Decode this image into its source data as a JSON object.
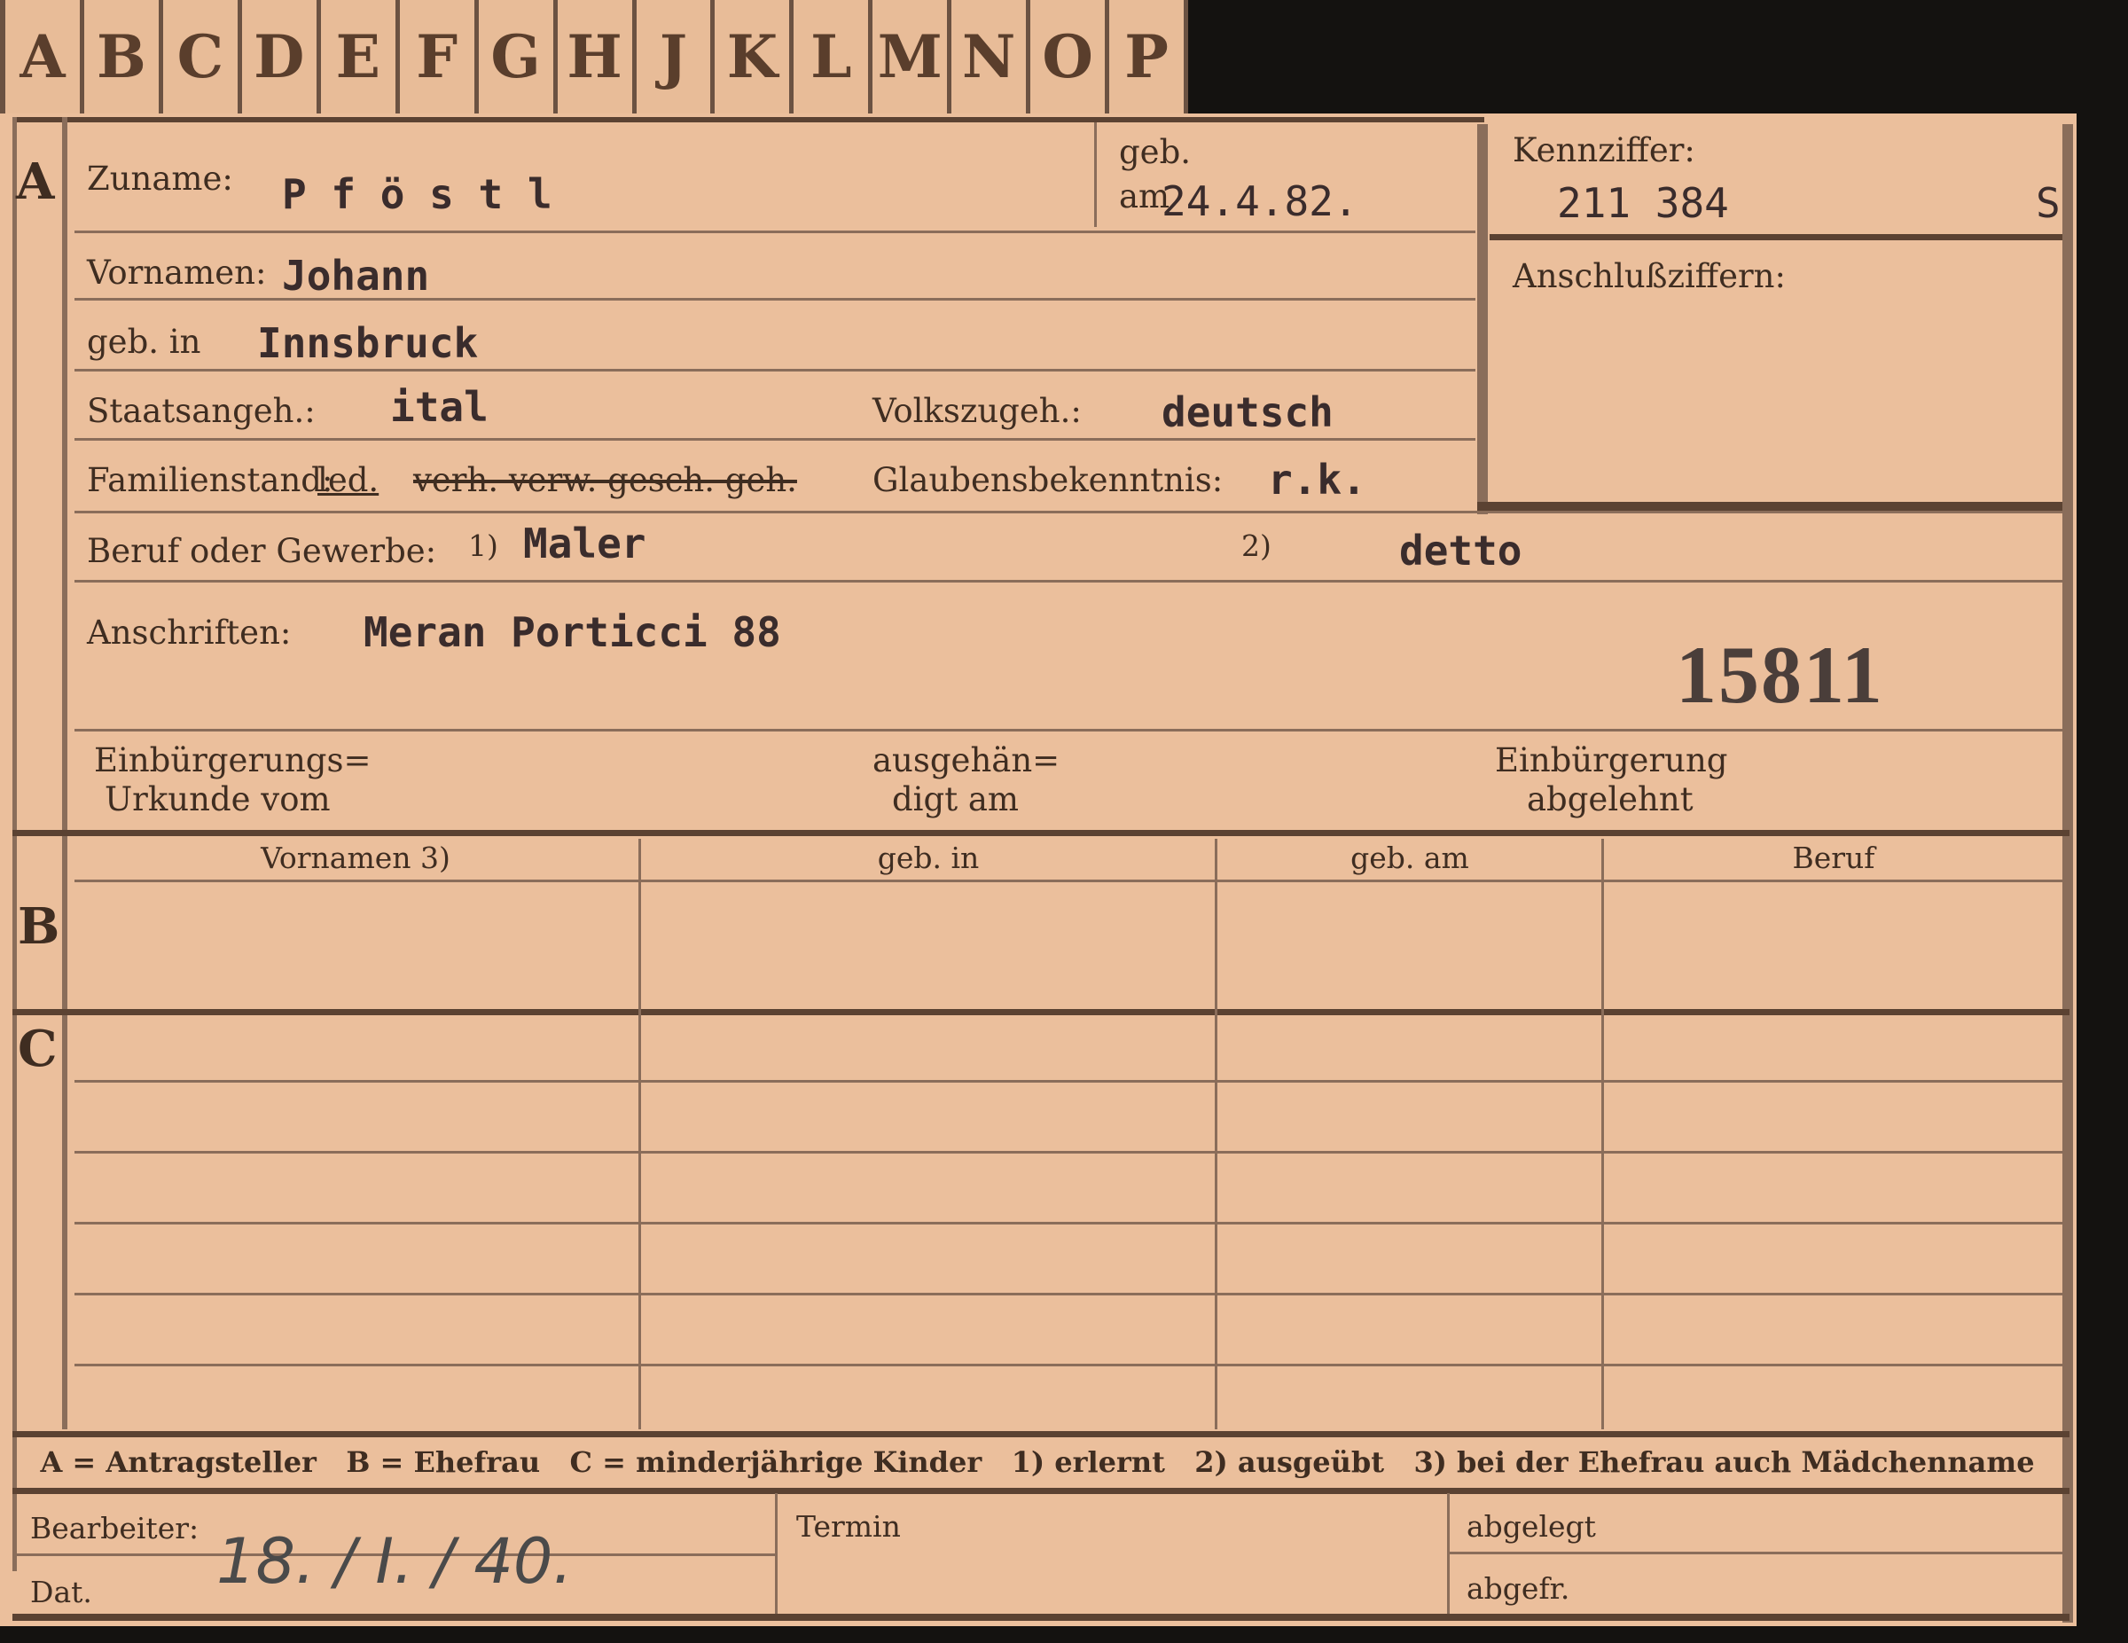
{
  "tabs": [
    "A",
    "B",
    "C",
    "D",
    "E",
    "F",
    "G",
    "H",
    "J",
    "K",
    "L",
    "M",
    "N",
    "O",
    "P"
  ],
  "sections": {
    "a": "A",
    "b": "B",
    "c": "C"
  },
  "header": {
    "zuname_label": "Zuname:",
    "zuname_value": "P f ö s t l",
    "geb_am_label_1": "geb.",
    "geb_am_label_2": "am",
    "geb_am_value": "24.4.82.",
    "kennziffer_label": "Kennziffer:",
    "kennziffer_value": "211 384",
    "kennziffer_suffix": "S",
    "anschluss_label": "Anschlußziffern:"
  },
  "fields": {
    "vornamen_label": "Vornamen:",
    "vornamen_value": "Johann",
    "geb_in_label": "geb. in",
    "geb_in_value": "Innsbruck",
    "staatsangeh_label": "Staatsangeh.:",
    "staatsangeh_value": "ital",
    "volkszugeh_label": "Volkszugeh.:",
    "volkszugeh_value": "deutsch",
    "familienstand_label": "Familienstand:",
    "familienstand_kept": "led.",
    "familienstand_struck": "verh. verw. gesch. geh.",
    "glauben_label": "Glaubensbekenntnis:",
    "glauben_value": "r.k.",
    "beruf_label": "Beruf oder Gewerbe:",
    "beruf_note1": "1)",
    "beruf_value1": "Maler",
    "beruf_note2": "2)",
    "beruf_value2": "detto",
    "anschriften_label": "Anschriften:",
    "anschriften_value": "Meran Porticci 88",
    "stamp_number": "15811",
    "einb_label_1": "Einbürgerungs=",
    "einb_label_2": "Urkunde vom",
    "ausgeh_label_1": "ausgehän=",
    "ausgeh_label_2": "digt am",
    "abgelehnt_label_1": "Einbürgerung",
    "abgelehnt_label_2": "abgelehnt"
  },
  "table": {
    "headers": [
      "Vornamen 3)",
      "geb. in",
      "geb. am",
      "Beruf"
    ]
  },
  "legend": {
    "text": "A = Antragsteller   B = Ehefrau   C = minderjährige Kinder   1) erlernt   2) ausgeübt   3) bei der Ehefrau auch Mädchenname"
  },
  "footer": {
    "bearbeiter_label": "Bearbeiter:",
    "dat_label": "Dat.",
    "dat_value": "18. / I. / 40.",
    "termin_label": "Termin",
    "abgelegt_label": "abgelegt",
    "abgefr_label": "abgefr."
  }
}
